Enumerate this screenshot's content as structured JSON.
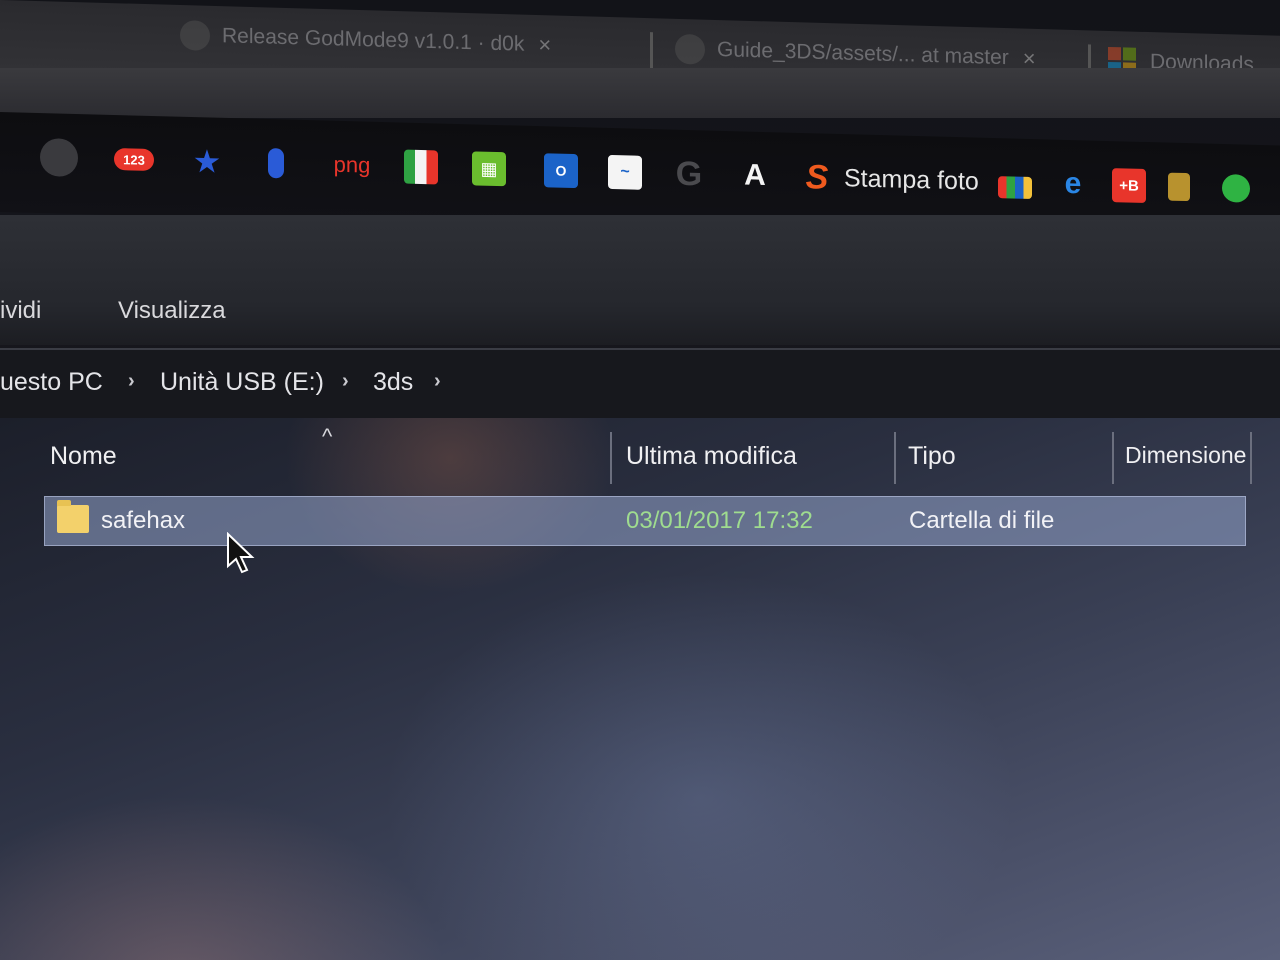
{
  "browser": {
    "tabs": [
      {
        "title": "Release GodMode9 v1.0.1 · d0k",
        "close": "×"
      },
      {
        "title": "Guide_3DS/assets/... at master",
        "close": "×"
      },
      {
        "title": "Downloads"
      }
    ]
  },
  "bookmarks": {
    "items": [
      {
        "icon": "chrome-app-icon"
      },
      {
        "icon": "counter-badge",
        "label": "123",
        "color": "#e8352b"
      },
      {
        "icon": "star-icon",
        "color": "#2a5bd7"
      },
      {
        "icon": "microphone-icon",
        "color": "#2a5bd7"
      },
      {
        "icon": "png-text-icon",
        "label": "png",
        "color": "#e8352b"
      },
      {
        "icon": "flag-icon"
      },
      {
        "icon": "green-grid-icon",
        "color": "#6abd2e"
      },
      {
        "icon": "outlook-icon",
        "color": "#1b63c8"
      },
      {
        "icon": "signature-icon"
      },
      {
        "icon": "google-icon",
        "label": "G"
      },
      {
        "icon": "witfe-icon",
        "label": "A"
      },
      {
        "icon": "s-logo-icon",
        "label": "S",
        "color": "#ef5a1e"
      },
      {
        "icon": "shopping-bag-icon"
      },
      {
        "icon": "ie-icon",
        "color": "#2a86e5"
      },
      {
        "icon": "plus-b-icon",
        "label": "+B",
        "color": "#e8352b"
      },
      {
        "icon": "lion-icon"
      },
      {
        "icon": "whatsapp-icon",
        "color": "#2fb343"
      }
    ],
    "stampa_label": "Stampa foto"
  },
  "ribbon": {
    "tabs": [
      "ividi",
      "Visualizza"
    ]
  },
  "address": {
    "crumbs": [
      "uesto PC",
      "Unità USB (E:)",
      "3ds"
    ],
    "separator": "›"
  },
  "filelist": {
    "columns": {
      "name": "Nome",
      "modified": "Ultima modifica",
      "type": "Tipo",
      "size": "Dimensione"
    },
    "sort_indicator": "^",
    "rows": [
      {
        "name": "safehax",
        "modified": "03/01/2017 17:32",
        "type": "Cartella di file",
        "size": ""
      }
    ]
  }
}
